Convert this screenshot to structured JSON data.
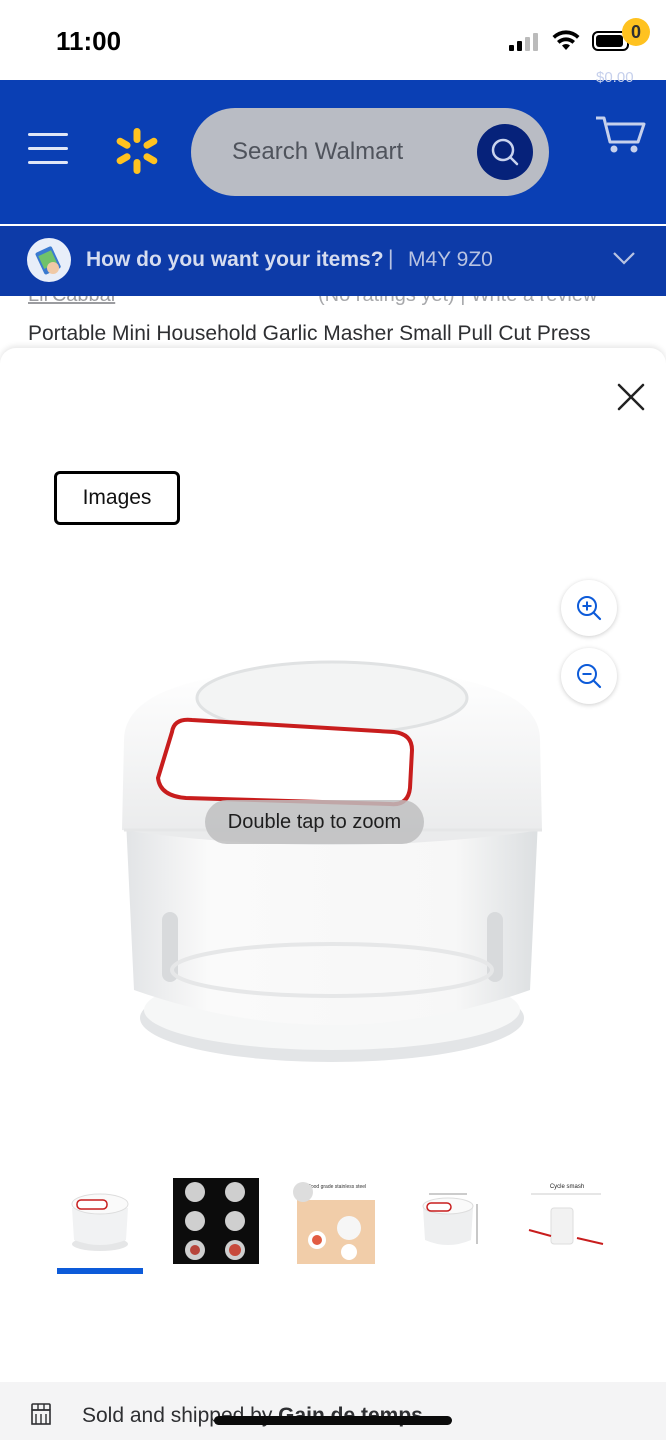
{
  "status_bar": {
    "time": "11:00"
  },
  "header": {
    "search_placeholder": "Search Walmart",
    "cart_count": "0",
    "cart_total": "$0.00",
    "icons": {
      "menu": "hamburger-icon",
      "logo": "walmart-spark-logo",
      "search": "search-icon",
      "cart": "cart-icon"
    },
    "colors": {
      "brand_blue": "#0a3fb4",
      "spark_yellow": "#ffc220"
    }
  },
  "fulfillment": {
    "question": "How do you want your items?",
    "separator": "|",
    "postal_code": "M4Y 9Z0"
  },
  "behind": {
    "link_fragment": "Lil'Cabbal",
    "rating_fragment": "(No ratings yet)  |  Write a review",
    "product_title": "Portable Mini Household Garlic Masher Small Pull Cut Press"
  },
  "viewer": {
    "tab_label": "Images",
    "tap_hint": "Double tap to zoom",
    "zoom_in_icon": "zoom-in-icon",
    "zoom_out_icon": "zoom-out-icon",
    "close_icon": "close-icon",
    "thumbnails": [
      {
        "label": "Product thumbnail 1"
      },
      {
        "label": "Product thumbnail 2"
      },
      {
        "label": "Product thumbnail 3",
        "caption": "Food grade stainless steel"
      },
      {
        "label": "Product thumbnail 4"
      },
      {
        "label": "Product thumbnail 5",
        "caption": "Cycle smash"
      }
    ],
    "selected_thumbnail": 1,
    "accent": "#0d5bd9"
  },
  "seller": {
    "prefix": "Sold and shipped by ",
    "name": "Gain de temps"
  }
}
